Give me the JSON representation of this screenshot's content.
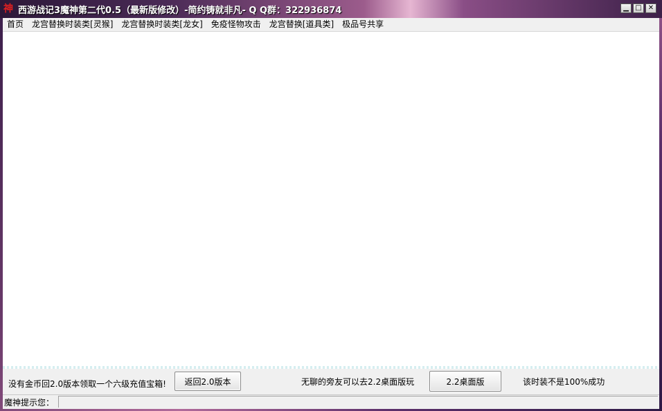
{
  "window": {
    "title": "西游战记3魔神第二代0.5（最新版修改）-简约铸就非凡-    Q  Q群：322936874",
    "icon_glyph": "神",
    "minimize_glyph": "▁",
    "maximize_glyph": "□",
    "close_glyph": "✕"
  },
  "menu": {
    "items": [
      {
        "label": "首页"
      },
      {
        "label": "龙宫替换时装类[灵猴]"
      },
      {
        "label": "龙宫替换时装类[龙女]"
      },
      {
        "label": "免疫怪物攻击"
      },
      {
        "label": "龙宫替换[道具类]"
      },
      {
        "label": "极品号共享"
      }
    ]
  },
  "panel": {
    "left_text": "没有金币回2.0版本领取一个六级充值宝箱!",
    "back_button": "返回2.0版本",
    "middle_text": "无聊的旁友可以去2.2桌面版玩",
    "desktop_button": "2.2桌面版",
    "right_text": "该时装不是100%成功"
  },
  "status": {
    "label": "魔神提示您：",
    "value": ""
  }
}
